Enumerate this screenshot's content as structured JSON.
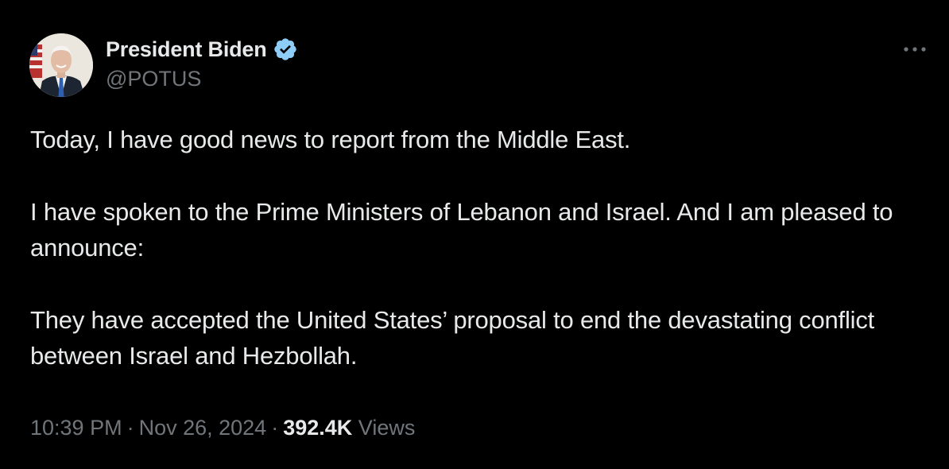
{
  "author": {
    "display_name": "President Biden",
    "handle": "@POTUS",
    "verified": true,
    "verified_color": "#8ecdf8",
    "avatar_icon": "profile-photo"
  },
  "tweet": {
    "paragraphs": [
      "Today, I have good news to report from the Middle East.",
      "I have spoken to the Prime Ministers of Lebanon and Israel. And I am pleased to announce:",
      "They have accepted the United States’ proposal to end the devastating conflict between Israel and Hezbollah."
    ]
  },
  "meta": {
    "time": "10:39 PM",
    "separator": "·",
    "date": "Nov 26, 2024",
    "views_count": "392.4K",
    "views_label": "Views"
  },
  "colors": {
    "background": "#000000",
    "text_primary": "#e7e9ea",
    "text_secondary": "#71767b"
  },
  "icons": {
    "more": "more-options-icon",
    "verified": "verified-badge-icon"
  }
}
